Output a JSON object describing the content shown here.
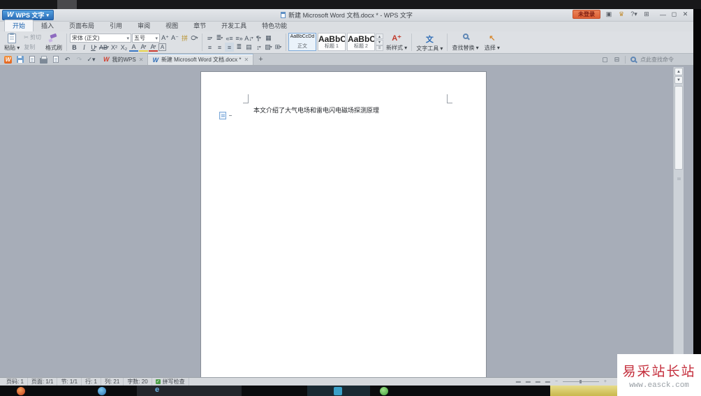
{
  "window": {
    "app_name": "WPS 文字",
    "title": "新建 Microsoft Word 文档.docx * - WPS 文字",
    "login": "未登录"
  },
  "menu_tabs": [
    "开始",
    "插入",
    "页面布局",
    "引用",
    "审阅",
    "视图",
    "章节",
    "开发工具",
    "特色功能"
  ],
  "ribbon": {
    "clipboard": {
      "paste": "粘贴",
      "cut": "剪切",
      "copy": "复制",
      "format_painter": "格式刷"
    },
    "font": {
      "family": "宋体 (正文)",
      "size": "五号"
    },
    "styles": [
      {
        "preview": "AaBbCcDd",
        "label": "正文"
      },
      {
        "preview": "AaBbC",
        "label": "标题 1"
      },
      {
        "preview": "AaBbC",
        "label": "标题 2"
      }
    ],
    "new_style": "新样式",
    "text_tool": "文字工具",
    "find_replace": "查找替换",
    "select": "选择"
  },
  "doc_tabs": {
    "home": "我的WPS",
    "document": "新建 Microsoft Word 文档.docx *",
    "search_placeholder": "点此查找命令"
  },
  "document": {
    "text": "本文介绍了大气电场和雷电闪电磁场探测原理"
  },
  "status_bar": {
    "page_number": "页码: 1",
    "page": "页面: 1/1",
    "section": "节: 1/1",
    "line": "行: 1",
    "column": "列: 21",
    "word_count": "字数: 20",
    "spell_check": "拼写检查"
  },
  "watermark": {
    "title": "易采站长站",
    "url": "www.easck.com"
  },
  "colors": {
    "accent_blue": "#2f6db6",
    "login_orange": "#dd5f33",
    "watermark_red": "#c42e3c"
  }
}
